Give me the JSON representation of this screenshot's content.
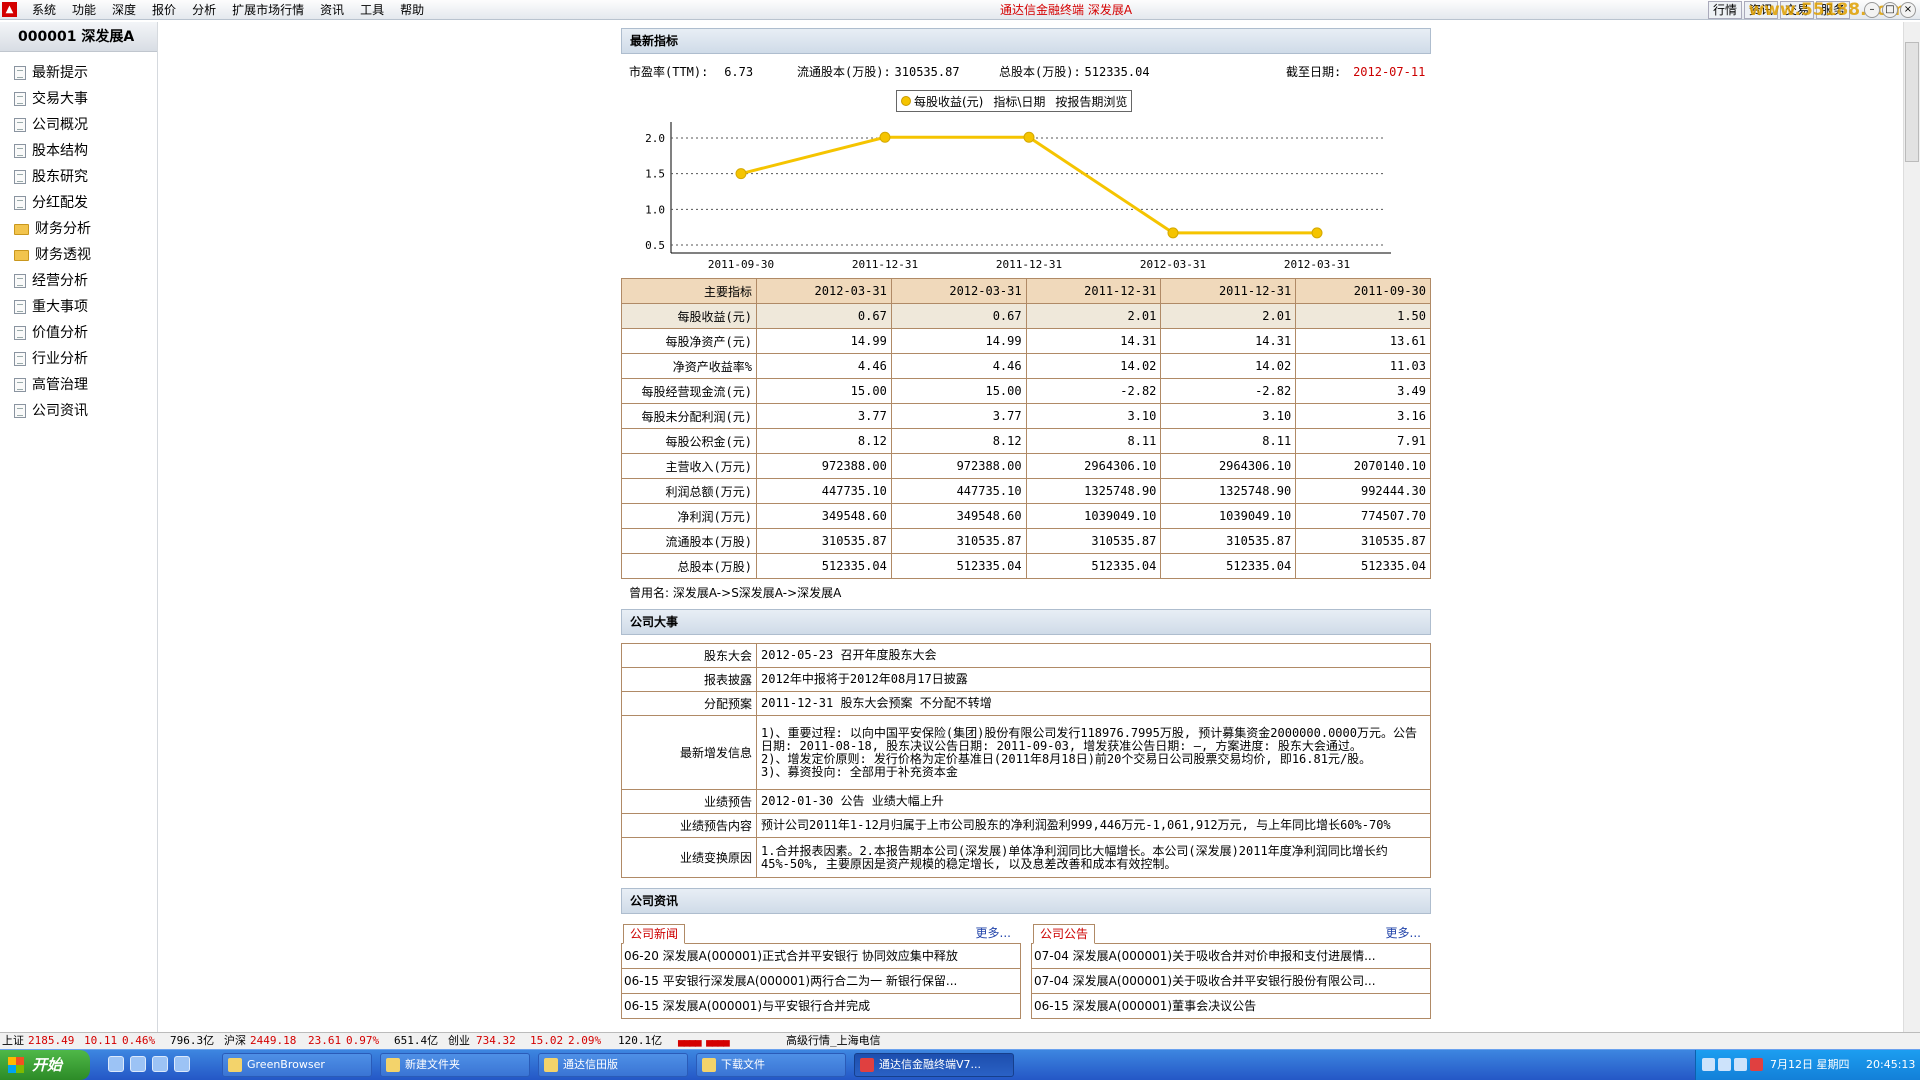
{
  "app": {
    "title": "通达信金融终端 深发展A",
    "menu": [
      "系统",
      "功能",
      "深度",
      "报价",
      "分析",
      "扩展市场行情",
      "资讯",
      "工具",
      "帮助"
    ],
    "top_buttons": [
      "行情",
      "资讯",
      "交易",
      "服务"
    ],
    "watermark": "www.55188.com"
  },
  "sidebar": {
    "stock": "000001 深发展A",
    "items": [
      {
        "label": "最新提示",
        "icon": "doc-icon"
      },
      {
        "label": "交易大事",
        "icon": "doc-icon"
      },
      {
        "label": "公司概况",
        "icon": "doc-icon"
      },
      {
        "label": "股本结构",
        "icon": "doc-icon"
      },
      {
        "label": "股东研究",
        "icon": "doc-icon"
      },
      {
        "label": "分红配发",
        "icon": "doc-icon"
      },
      {
        "label": "财务分析",
        "icon": "folder-icon"
      },
      {
        "label": "财务透视",
        "icon": "folder-icon"
      },
      {
        "label": "经营分析",
        "icon": "doc-icon"
      },
      {
        "label": "重大事项",
        "icon": "doc-icon"
      },
      {
        "label": "价值分析",
        "icon": "doc-icon"
      },
      {
        "label": "行业分析",
        "icon": "doc-icon"
      },
      {
        "label": "高管治理",
        "icon": "doc-icon"
      },
      {
        "label": "公司资讯",
        "icon": "doc-icon"
      }
    ]
  },
  "latest": {
    "header": "最新指标",
    "pe_label": "市盈率(TTM):",
    "pe_value": "6.73",
    "float_label": "流通股本(万股):",
    "float_value": "310535.87",
    "total_label": "总股本(万股):",
    "total_value": "512335.04",
    "date_label": "截至日期:",
    "date_value": "2012-07-11",
    "legend": {
      "series": "每股收益(元)",
      "axis": "指标\\日期",
      "mode": "按报告期浏览"
    }
  },
  "chart_data": {
    "type": "line",
    "categories": [
      "2011-09-30",
      "2011-12-31",
      "2011-12-31",
      "2012-03-31",
      "2012-03-31"
    ],
    "series": [
      {
        "name": "每股收益(元)",
        "values": [
          1.5,
          2.01,
          2.01,
          0.67,
          0.67
        ],
        "color": "#f5c400"
      }
    ],
    "yticks": [
      "2.0",
      "1.5",
      "1.0",
      "0.5"
    ],
    "ylim": [
      0.5,
      2.0
    ],
    "grid": true,
    "legend": "top"
  },
  "fin_table": {
    "headers": [
      "主要指标",
      "2012-03-31",
      "2012-03-31",
      "2011-12-31",
      "2011-12-31",
      "2011-09-30"
    ],
    "rows": [
      [
        "每股收益(元)",
        "0.67",
        "0.67",
        "2.01",
        "2.01",
        "1.50"
      ],
      [
        "每股净资产(元)",
        "14.99",
        "14.99",
        "14.31",
        "14.31",
        "13.61"
      ],
      [
        "净资产收益率%",
        "4.46",
        "4.46",
        "14.02",
        "14.02",
        "11.03"
      ],
      [
        "每股经营现金流(元)",
        "15.00",
        "15.00",
        "-2.82",
        "-2.82",
        "3.49"
      ],
      [
        "每股未分配利润(元)",
        "3.77",
        "3.77",
        "3.10",
        "3.10",
        "3.16"
      ],
      [
        "每股公积金(元)",
        "8.12",
        "8.12",
        "8.11",
        "8.11",
        "7.91"
      ],
      [
        "主营收入(万元)",
        "972388.00",
        "972388.00",
        "2964306.10",
        "2964306.10",
        "2070140.10"
      ],
      [
        "利润总额(万元)",
        "447735.10",
        "447735.10",
        "1325748.90",
        "1325748.90",
        "992444.30"
      ],
      [
        "净利润(万元)",
        "349548.60",
        "349548.60",
        "1039049.10",
        "1039049.10",
        "774507.70"
      ],
      [
        "流通股本(万股)",
        "310535.87",
        "310535.87",
        "310535.87",
        "310535.87",
        "310535.87"
      ],
      [
        "总股本(万股)",
        "512335.04",
        "512335.04",
        "512335.04",
        "512335.04",
        "512335.04"
      ]
    ],
    "former_names": "曾用名: 深发展A->S深发展A->深发展A"
  },
  "events": {
    "header": "公司大事",
    "rows": [
      {
        "k": "股东大会",
        "v": "2012-05-23 召开年度股东大会"
      },
      {
        "k": "报表披露",
        "v": "2012年中报将于2012年08月17日披露"
      },
      {
        "k": "分配预案",
        "v": "2011-12-31 股东大会预案 不分配不转增"
      },
      {
        "k": "最新增发信息",
        "v": "1)、重要过程: 以向中国平安保险(集团)股份有限公司发行118976.7995万股, 预计募集资金2000000.0000万元。公告日期: 2011-08-18, 股东决议公告日期: 2011-09-03, 增发获准公告日期: —, 方案进度: 股东大会通过。\n2)、增发定价原则: 发行价格为定价基准日(2011年8月18日)前20个交易日公司股票交易均价, 即16.81元/股。\n3)、募资投向: 全部用于补充资本金"
      },
      {
        "k": "业绩预告",
        "v": "2012-01-30 公告 业绩大幅上升"
      },
      {
        "k": "业绩预告内容",
        "v": "预计公司2011年1-12月归属于上市公司股东的净利润盈利999,446万元-1,061,912万元, 与上年同比增长60%-70%"
      },
      {
        "k": "业绩变换原因",
        "v": "1.合并报表因素。2.本报告期本公司(深发展)单体净利润同比大幅增长。本公司(深发展)2011年度净利润同比增长约45%-50%, 主要原因是资产规模的稳定增长, 以及息差改善和成本有效控制。"
      }
    ]
  },
  "news": {
    "header": "公司资讯",
    "more": "更多...",
    "left": {
      "tab": "公司新闻",
      "items": [
        "06-20 深发展A(000001)正式合并平安银行 协同效应集中释放",
        "06-15 平安银行深发展A(000001)两行合二为一 新银行保留...",
        "06-15 深发展A(000001)与平安银行合并完成"
      ]
    },
    "right": {
      "tab": "公司公告",
      "items": [
        "07-04 深发展A(000001)关于吸收合并对价申报和支付进展情...",
        "07-04 深发展A(000001)关于吸收合并平安银行股份有限公司...",
        "06-15 深发展A(000001)董事会决议公告"
      ]
    }
  },
  "statusbar": {
    "sh_label": "上证",
    "sh_value": "2185.49",
    "sh_change": "10.11",
    "sh_pct": "0.46%",
    "sh_amt": "796.3亿",
    "hs_label": "沪深",
    "hs_value": "2449.18",
    "hs_change": "23.61",
    "hs_pct": "0.97%",
    "hs_amt": "651.4亿",
    "cy_label": "创业",
    "cy_value": "734.32",
    "cy_change": "15.02",
    "cy_pct": "2.09%",
    "cy_amt": "120.1亿",
    "info": "高级行情_上海电信"
  },
  "taskbar": {
    "start": "开始",
    "tasks": [
      "GreenBrowser",
      "新建文件夹",
      "通达信田版",
      "下载文件",
      "通达信金融终端V7..."
    ],
    "date": "7月12日 星期四",
    "time": "20:45:13"
  }
}
